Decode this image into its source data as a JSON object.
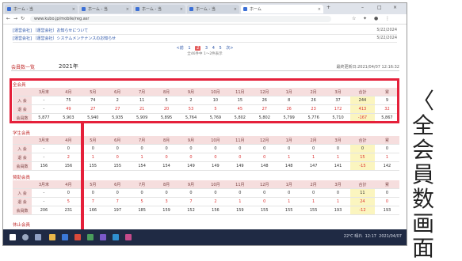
{
  "browser": {
    "tabs": [
      {
        "title": "ホーム - 当"
      },
      {
        "title": "ホーム - 当"
      },
      {
        "title": "ホーム - 当"
      },
      {
        "title": "ホーム - 当"
      },
      {
        "title": "ホーム"
      }
    ],
    "new_tab": "+",
    "url": "www.kubo.jp/mobile/reg.asr",
    "controls": {
      "minimize": "–",
      "maximize": "□",
      "close": "×"
    }
  },
  "notices": [
    {
      "text": "[運営会社] 〔運営会社〕お知らせについて",
      "date": "5/22/2024"
    },
    {
      "text": "[運営会社] 〔運営会社〕システムメンテナンスのお知らせ",
      "date": "5/22/2024"
    }
  ],
  "pager": {
    "prev": "<前",
    "pages": [
      "1",
      "2",
      "3",
      "4",
      "5"
    ],
    "current": "2",
    "next": "次>",
    "info": "全46件中 1～2件表示"
  },
  "history": {
    "title": "会員数一覧",
    "year": "2021年",
    "updated": "最終更新日:2021/04/07 12:16:32"
  },
  "months": [
    "3月末",
    "4月",
    "5月",
    "6月",
    "7月",
    "8月",
    "9月",
    "10月",
    "11月",
    "12月",
    "1月",
    "2月",
    "3月",
    "合計",
    "累"
  ],
  "sections": [
    {
      "title": "全会員",
      "rows": [
        {
          "label": "入 会",
          "cells": [
            "-",
            "75",
            "74",
            "2",
            "11",
            "5",
            "2",
            "10",
            "15",
            "26",
            "8",
            "26",
            "37",
            "244",
            "9"
          ]
        },
        {
          "label": "退 会",
          "cells": [
            "-",
            "49",
            "27",
            "27",
            "21",
            "20",
            "53",
            "5",
            "45",
            "27",
            "26",
            "23",
            "172",
            "413",
            "32"
          ]
        },
        {
          "label": "会員数",
          "cells": [
            "5,877",
            "5,903",
            "5,940",
            "5,935",
            "5,909",
            "5,895",
            "5,764",
            "5,769",
            "5,802",
            "5,802",
            "5,799",
            "5,776",
            "5,710",
            "-167",
            "5,867"
          ]
        }
      ]
    },
    {
      "title": "学生会員",
      "rows": [
        {
          "label": "入 会",
          "cells": [
            "-",
            "0",
            "0",
            "0",
            "0",
            "0",
            "0",
            "0",
            "0",
            "0",
            "0",
            "0",
            "0",
            "0",
            "0"
          ]
        },
        {
          "label": "退 会",
          "cells": [
            "-",
            "2",
            "1",
            "0",
            "1",
            "0",
            "0",
            "0",
            "0",
            "0",
            "1",
            "1",
            "1",
            "15",
            "1"
          ]
        },
        {
          "label": "会員数",
          "cells": [
            "156",
            "156",
            "155",
            "155",
            "154",
            "154",
            "149",
            "149",
            "149",
            "148",
            "148",
            "147",
            "141",
            "-15",
            "142"
          ]
        }
      ]
    },
    {
      "title": "賛助会員",
      "rows": [
        {
          "label": "入 会",
          "cells": [
            "-",
            "0",
            "0",
            "0",
            "0",
            "0",
            "0",
            "0",
            "0",
            "0",
            "0",
            "0",
            "0",
            "11",
            "0"
          ]
        },
        {
          "label": "退 会",
          "cells": [
            "-",
            "5",
            "7",
            "7",
            "5",
            "3",
            "7",
            "2",
            "1",
            "0",
            "1",
            "1",
            "1",
            "24",
            "0"
          ]
        },
        {
          "label": "会員数",
          "cells": [
            "206",
            "231",
            "166",
            "197",
            "185",
            "159",
            "152",
            "156",
            "159",
            "155",
            "155",
            "155",
            "193",
            "-12",
            "193"
          ]
        }
      ]
    },
    {
      "title": "休止会員",
      "rows": []
    }
  ],
  "taskbar": {
    "tray_text": "22℃ 晴れ",
    "time": "12:17",
    "date": "2021/04/07"
  },
  "caption": [
    "〈",
    "全",
    "会",
    "員",
    "数",
    "画",
    "面",
    "〉"
  ],
  "colors": {
    "highlight": "#e5203a",
    "header_bg": "#f6dede",
    "total_bg": "#fbf5bf",
    "section_title": "#c23030"
  }
}
